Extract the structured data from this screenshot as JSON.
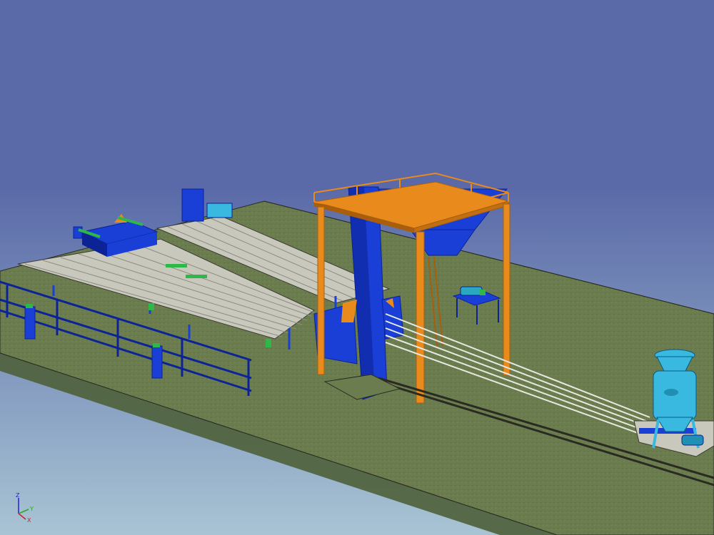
{
  "viewport": {
    "background": {
      "top": "#5a6aa8",
      "bottom": "#a8c4d4"
    },
    "colors": {
      "ground_top": "#6b7d4f",
      "ground_side": "#5a6d44",
      "structure_blue": "#1a3fd6",
      "structure_blue_dark": "#0c2396",
      "gantry_orange": "#e88a1c",
      "gantry_orange_dark": "#a85e0c",
      "pipe": "#c8c8bc",
      "pipe_edge": "#3a3a34",
      "tank_cyan": "#39b8e0",
      "accent_green": "#2fb84a",
      "motor_teal": "#2aa8c0"
    }
  },
  "axis_triad": {
    "labels": {
      "z": "Z",
      "y": "Y",
      "x": "X"
    },
    "colors": {
      "z": "#2222cc",
      "y": "#22aa22",
      "x": "#cc2222"
    }
  }
}
